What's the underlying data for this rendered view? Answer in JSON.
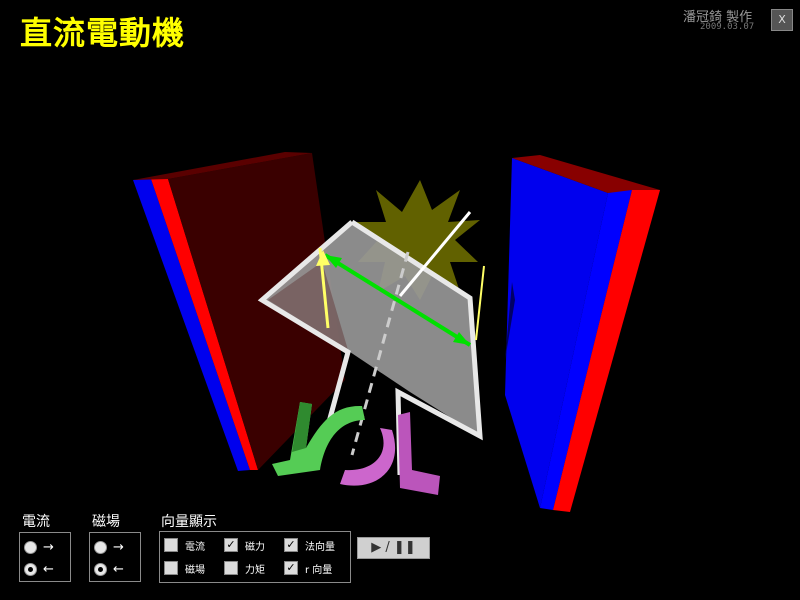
{
  "header": {
    "title": "直流電動機",
    "author": "潘冠錡 製作",
    "date": "2009.03.07",
    "close_label": "X"
  },
  "current_panel": {
    "label": "電流",
    "options": [
      {
        "label": "→",
        "selected": false
      },
      {
        "label": "←",
        "selected": true
      }
    ]
  },
  "field_panel": {
    "label": "磁場",
    "options": [
      {
        "label": "→",
        "selected": false
      },
      {
        "label": "←",
        "selected": true
      }
    ]
  },
  "vector_panel": {
    "label": "向量顯示",
    "items": [
      {
        "label": "電流",
        "checked": false,
        "mark": ""
      },
      {
        "label": "磁力",
        "checked": true,
        "mark": "✓"
      },
      {
        "label": "法向量",
        "checked": true,
        "mark": "✓"
      },
      {
        "label": "磁場",
        "checked": false,
        "mark": ""
      },
      {
        "label": "力矩",
        "checked": false,
        "mark": ""
      },
      {
        "label": "r 向量",
        "checked": true,
        "mark": "✓"
      }
    ]
  },
  "play_button": {
    "label": "▶ / ❚❚"
  },
  "colors": {
    "title": "#ffff00",
    "magnet_red": "#ff0000",
    "magnet_blue": "#0000ff",
    "force_vector": "#ffff66",
    "normal_vector": "#00e000",
    "r_vector": "#ffffff",
    "commutator_green": "#55cc55",
    "brush_purple": "#cc66cc"
  }
}
